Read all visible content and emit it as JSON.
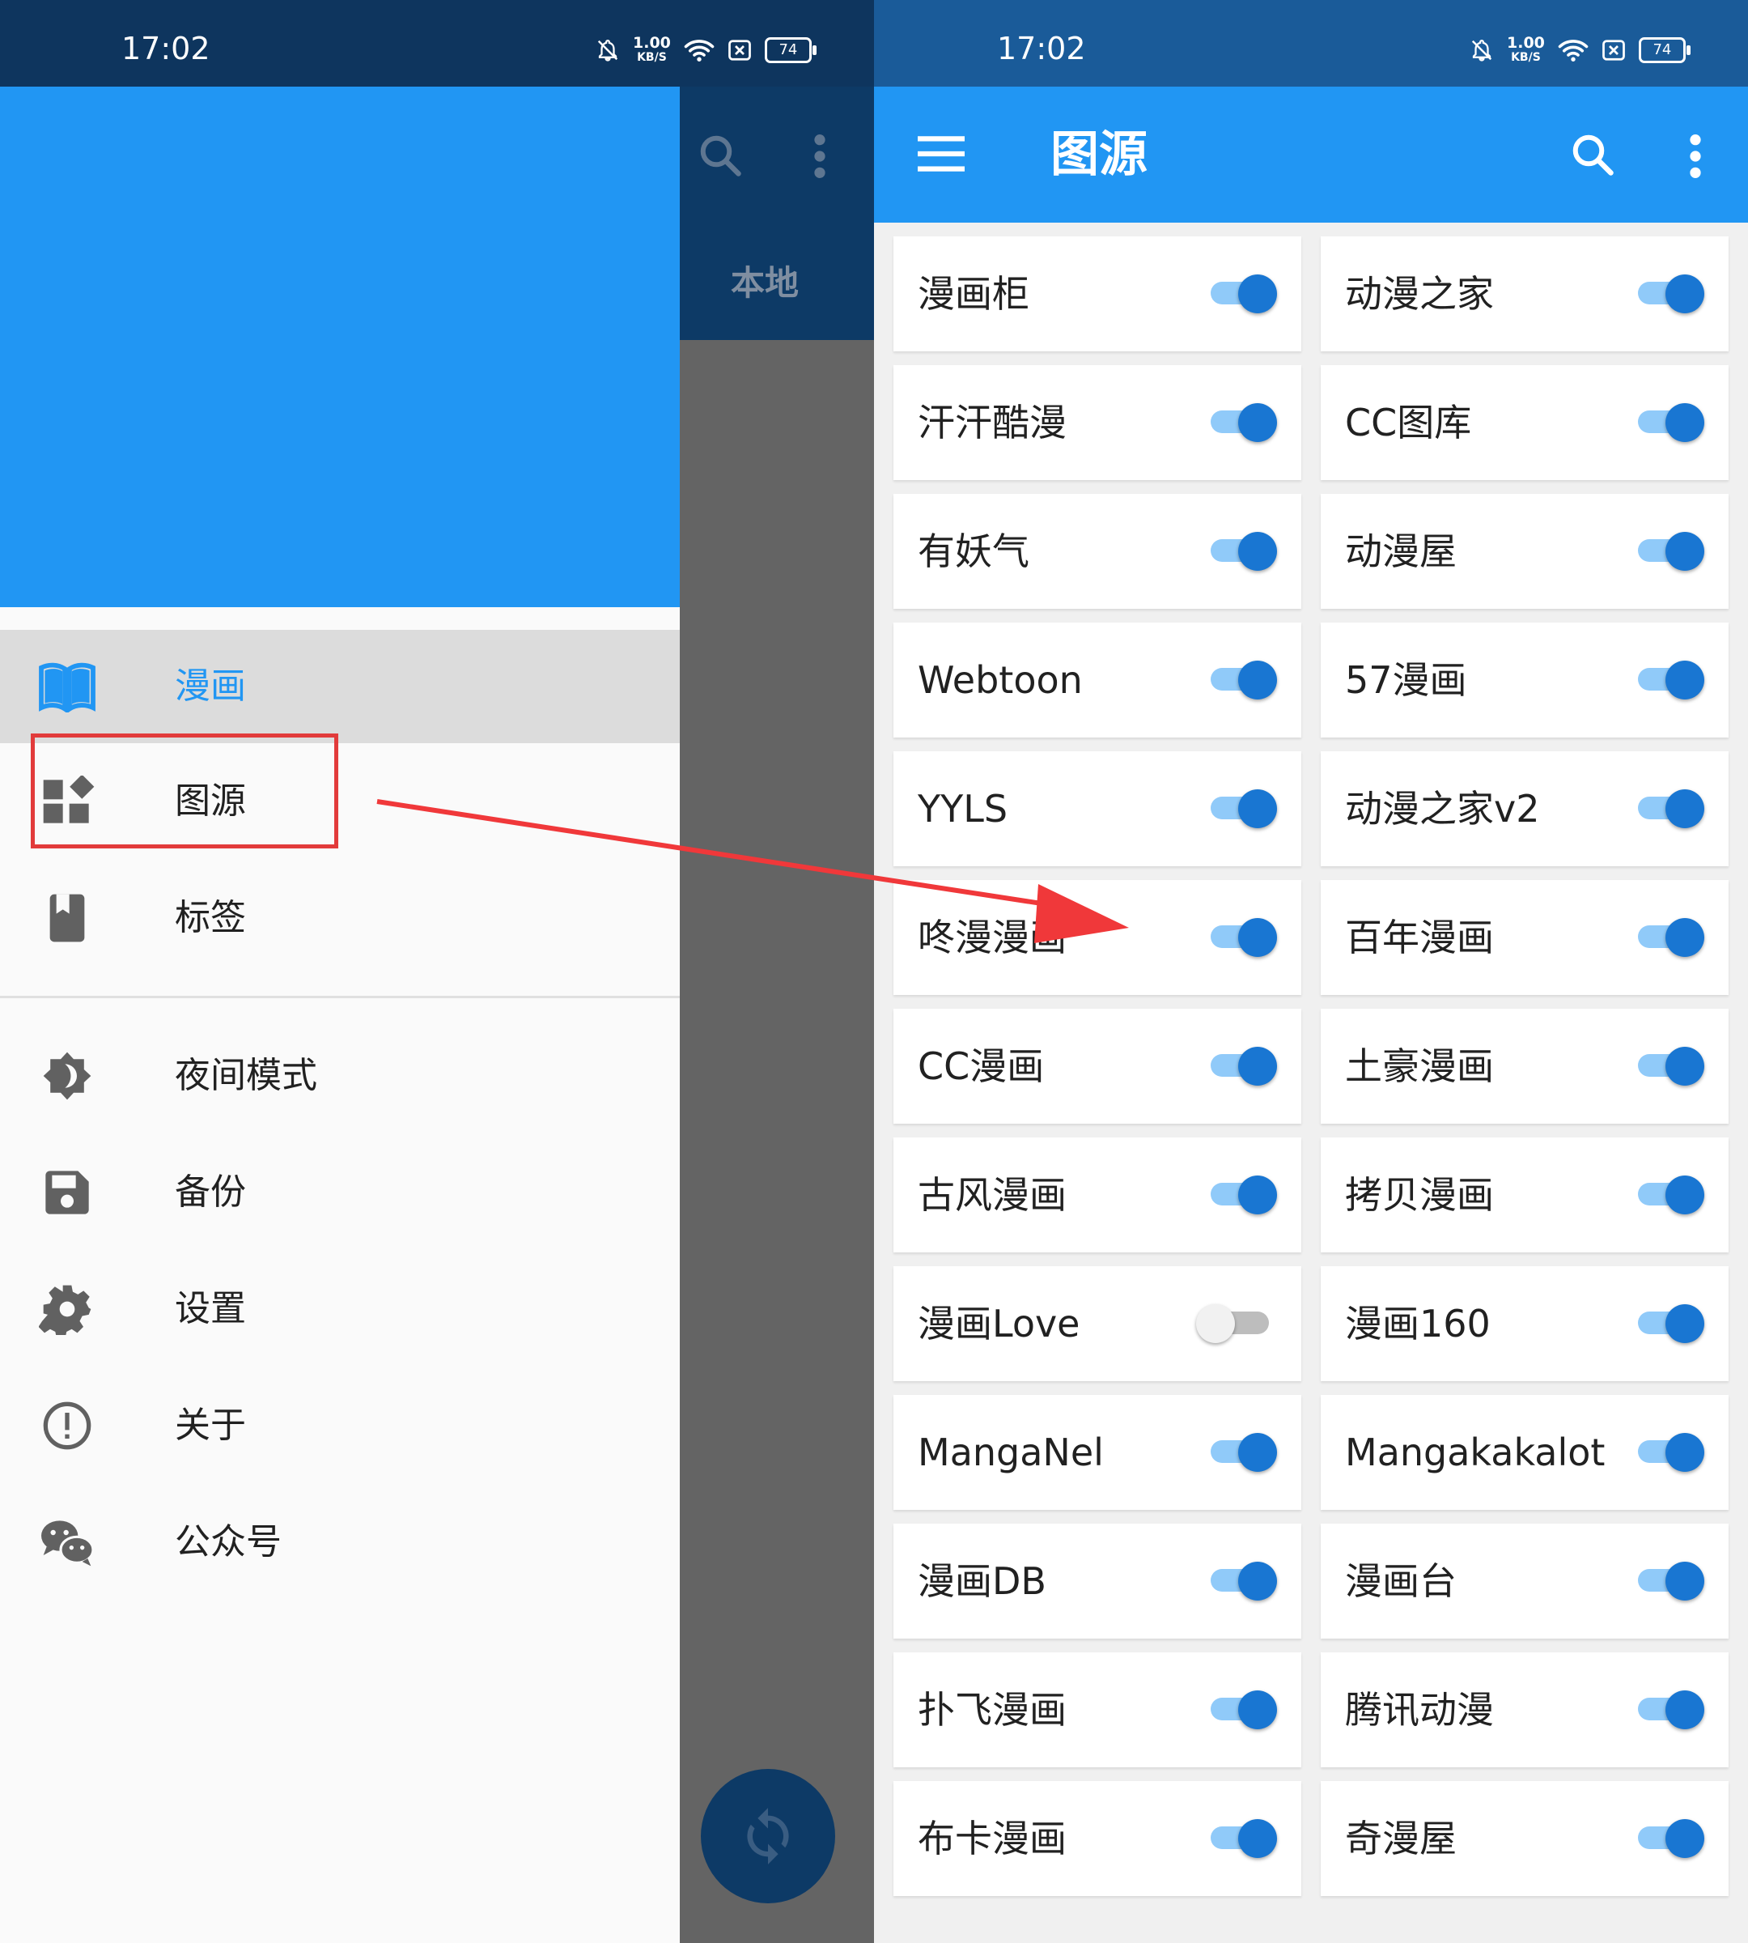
{
  "left_screen": {
    "status_bar": {
      "time": "17:02",
      "net_speed_value": "1.00",
      "net_speed_unit": "KB/S",
      "battery": "74"
    },
    "background_tab": "本地",
    "drawer_items": [
      {
        "label": "漫画",
        "icon": "book-icon",
        "active": true
      },
      {
        "label": "图源",
        "icon": "widgets-icon",
        "highlighted": true
      },
      {
        "label": "标签",
        "icon": "bookmark-icon"
      },
      {
        "label": "夜间模式",
        "icon": "brightness-icon"
      },
      {
        "label": "备份",
        "icon": "save-icon"
      },
      {
        "label": "设置",
        "icon": "gear-icon"
      },
      {
        "label": "关于",
        "icon": "info-icon"
      },
      {
        "label": "公众号",
        "icon": "wechat-icon"
      }
    ]
  },
  "right_screen": {
    "status_bar": {
      "time": "17:02",
      "net_speed_value": "1.00",
      "net_speed_unit": "KB/S",
      "battery": "74"
    },
    "toolbar": {
      "title": "图源"
    },
    "sources": [
      {
        "name": "漫画柜",
        "enabled": true
      },
      {
        "name": "动漫之家",
        "enabled": true
      },
      {
        "name": "汗汗酷漫",
        "enabled": true
      },
      {
        "name": "CC图库",
        "enabled": true
      },
      {
        "name": "有妖气",
        "enabled": true
      },
      {
        "name": "动漫屋",
        "enabled": true
      },
      {
        "name": "Webtoon",
        "enabled": true
      },
      {
        "name": "57漫画",
        "enabled": true
      },
      {
        "name": "YYLS",
        "enabled": true
      },
      {
        "name": "动漫之家v2",
        "enabled": true
      },
      {
        "name": "咚漫漫画",
        "enabled": true
      },
      {
        "name": "百年漫画",
        "enabled": true
      },
      {
        "name": "CC漫画",
        "enabled": true
      },
      {
        "name": "土豪漫画",
        "enabled": true
      },
      {
        "name": "古风漫画",
        "enabled": true
      },
      {
        "name": "拷贝漫画",
        "enabled": true
      },
      {
        "name": "漫画Love",
        "enabled": false
      },
      {
        "name": "漫画160",
        "enabled": true
      },
      {
        "name": "MangaNel",
        "enabled": true
      },
      {
        "name": "Mangakakalot",
        "enabled": true
      },
      {
        "name": "漫画DB",
        "enabled": true
      },
      {
        "name": "漫画台",
        "enabled": true
      },
      {
        "name": "扑飞漫画",
        "enabled": true
      },
      {
        "name": "腾讯动漫",
        "enabled": true
      },
      {
        "name": "布卡漫画",
        "enabled": true
      },
      {
        "name": "奇漫屋",
        "enabled": true
      }
    ]
  },
  "colors": {
    "primary": "#2196f3",
    "primary_dark": "#0e355e",
    "switch_on": "#1976d2",
    "annotation_red": "#e23b3b"
  }
}
